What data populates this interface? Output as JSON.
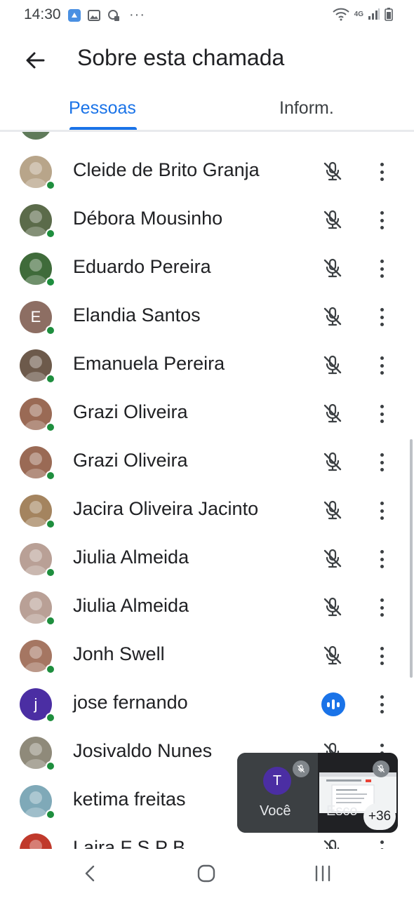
{
  "status_bar": {
    "time": "14:30",
    "more_label": "···",
    "network_label": "4G"
  },
  "app_bar": {
    "title": "Sobre esta chamada"
  },
  "tabs": [
    {
      "label": "Pessoas",
      "selected": true
    },
    {
      "label": "Inform.",
      "selected": false
    }
  ],
  "participants": [
    {
      "name": "Cleide de Brito Granja",
      "mic": "muted",
      "avatar": "photo",
      "color": "#b8a58a"
    },
    {
      "name": "Débora Mousinho",
      "mic": "muted",
      "avatar": "photo",
      "color": "#5b6b4a"
    },
    {
      "name": "Eduardo Pereira",
      "mic": "muted",
      "avatar": "photo",
      "color": "#3f6b3a"
    },
    {
      "name": "Elandia Santos",
      "mic": "muted",
      "avatar": "initial",
      "initial": "E",
      "color": "#8d6e63"
    },
    {
      "name": "Emanuela Pereira",
      "mic": "muted",
      "avatar": "photo",
      "color": "#6d5a4b"
    },
    {
      "name": "Grazi Oliveira",
      "mic": "muted",
      "avatar": "photo",
      "color": "#9a6a55"
    },
    {
      "name": "Grazi Oliveira",
      "mic": "muted",
      "avatar": "photo",
      "color": "#9a6a55"
    },
    {
      "name": "Jacira Oliveira Jacinto",
      "mic": "muted",
      "avatar": "photo",
      "color": "#a4845f"
    },
    {
      "name": "Jiulia Almeida",
      "mic": "muted",
      "avatar": "photo",
      "color": "#b9a096"
    },
    {
      "name": "Jiulia Almeida",
      "mic": "muted",
      "avatar": "photo",
      "color": "#b9a096"
    },
    {
      "name": "Jonh Swell",
      "mic": "muted",
      "avatar": "photo",
      "color": "#a57662"
    },
    {
      "name": "jose fernando",
      "mic": "speaking",
      "avatar": "initial",
      "initial": "j",
      "color": "#4b2ea3"
    },
    {
      "name": "Josivaldo Nunes",
      "mic": "muted",
      "avatar": "photo",
      "color": "#8f8a7a"
    },
    {
      "name": "ketima freitas",
      "mic": "muted",
      "avatar": "photo",
      "color": "#7fa9b8"
    },
    {
      "name": "Laira F S P B",
      "mic": "muted",
      "avatar": "photo",
      "color": "#c0392b"
    }
  ],
  "pip": {
    "self_initial": "T",
    "self_label": "Você",
    "self_avatar_color": "#4b2ea3",
    "screen_label": "Esco",
    "more_count": "+36"
  },
  "colors": {
    "accent": "#1a73e8",
    "presence": "#1e8e3e"
  }
}
